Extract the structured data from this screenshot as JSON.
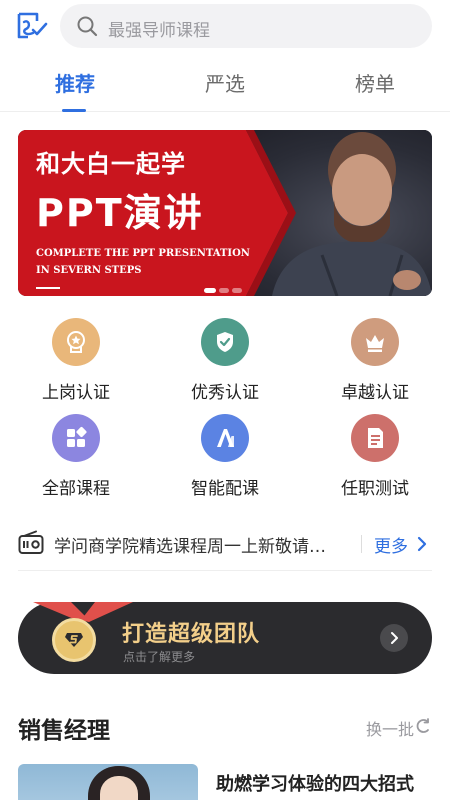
{
  "search": {
    "placeholder": "最强导师课程"
  },
  "tabs": [
    {
      "label": "推荐",
      "active": true
    },
    {
      "label": "严选",
      "active": false
    },
    {
      "label": "榜单",
      "active": false
    }
  ],
  "banner": {
    "line1": "和大白一起学",
    "line2": "PPT演讲",
    "line3": "COMPLETE THE PPT PRESENTATION",
    "line4": "IN SEVERN STEPS",
    "slide_count": 3,
    "active_slide": 1
  },
  "certifications": [
    {
      "label": "上岗认证",
      "icon": "badge-star-icon",
      "color": "#e9b77a"
    },
    {
      "label": "优秀认证",
      "icon": "shield-check-icon",
      "color": "#4f9c8b"
    },
    {
      "label": "卓越认证",
      "icon": "crown-icon",
      "color": "#cf9c7e"
    },
    {
      "label": "全部课程",
      "icon": "grid-icon",
      "color": "#8c86e0"
    },
    {
      "label": "智能配课",
      "icon": "ai-icon",
      "color": "#5b83e3"
    },
    {
      "label": "任职测试",
      "icon": "document-icon",
      "color": "#cd706b"
    }
  ],
  "notice": {
    "icon": "radio-icon",
    "text": "学问商学院精选课程周一上新敬请…",
    "more": "更多"
  },
  "team": {
    "title": "打造超级团队",
    "subtitle": "点击了解更多",
    "icon": "medal-icon"
  },
  "section": {
    "title": "销售经理",
    "refresh": "换一批"
  },
  "course": {
    "title": "助燃学习体验的四大招式"
  },
  "colors": {
    "accent": "#2f6fe0",
    "banner_red": "#c9151e",
    "team_bg": "#2b2b2e",
    "team_gold": "#f3cf8a"
  }
}
